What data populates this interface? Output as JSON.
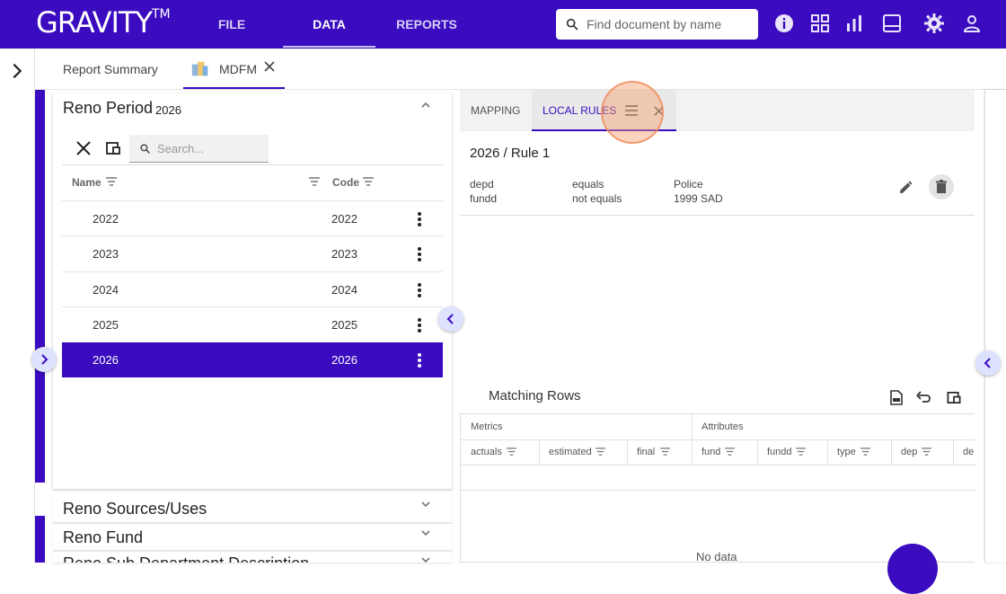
{
  "app": {
    "logo": "GRAVITY",
    "logo_tm": "TM",
    "nav": [
      "FILE",
      "DATA",
      "REPORTS"
    ],
    "search_placeholder": "Find document by name"
  },
  "doc_tabs": {
    "report_summary": "Report Summary",
    "mdfm": "MDFM"
  },
  "left_panel": {
    "title": "Reno Period",
    "subtitle": "2026",
    "search_placeholder": "Search...",
    "columns": {
      "name": "Name",
      "code": "Code"
    },
    "rows": [
      {
        "name": "2022",
        "code": "2022"
      },
      {
        "name": "2023",
        "code": "2023"
      },
      {
        "name": "2024",
        "code": "2024"
      },
      {
        "name": "2025",
        "code": "2025"
      },
      {
        "name": "2026",
        "code": "2026",
        "selected": true
      }
    ]
  },
  "accordions": [
    "Reno Sources/Uses",
    "Reno Fund",
    "Reno Sub Department Description"
  ],
  "right_panel": {
    "tabs": [
      "MAPPING",
      "LOCAL RULES"
    ],
    "rule_title": "2026 / Rule 1",
    "rules": [
      {
        "field": "depd",
        "op": "equals",
        "value": "Police"
      },
      {
        "field": "fundd",
        "op": "not equals",
        "value": "1999 SAD"
      }
    ],
    "matching_title": "Matching Rows",
    "groups": {
      "metrics": "Metrics",
      "attributes": "Attributes"
    },
    "columns": [
      "actuals",
      "estimated",
      "final",
      "fund",
      "fundd",
      "type",
      "dep",
      "de"
    ],
    "empty_text": "No data"
  },
  "colors": {
    "brand": "#3a0bbf",
    "highlight": "#f5a06e"
  }
}
